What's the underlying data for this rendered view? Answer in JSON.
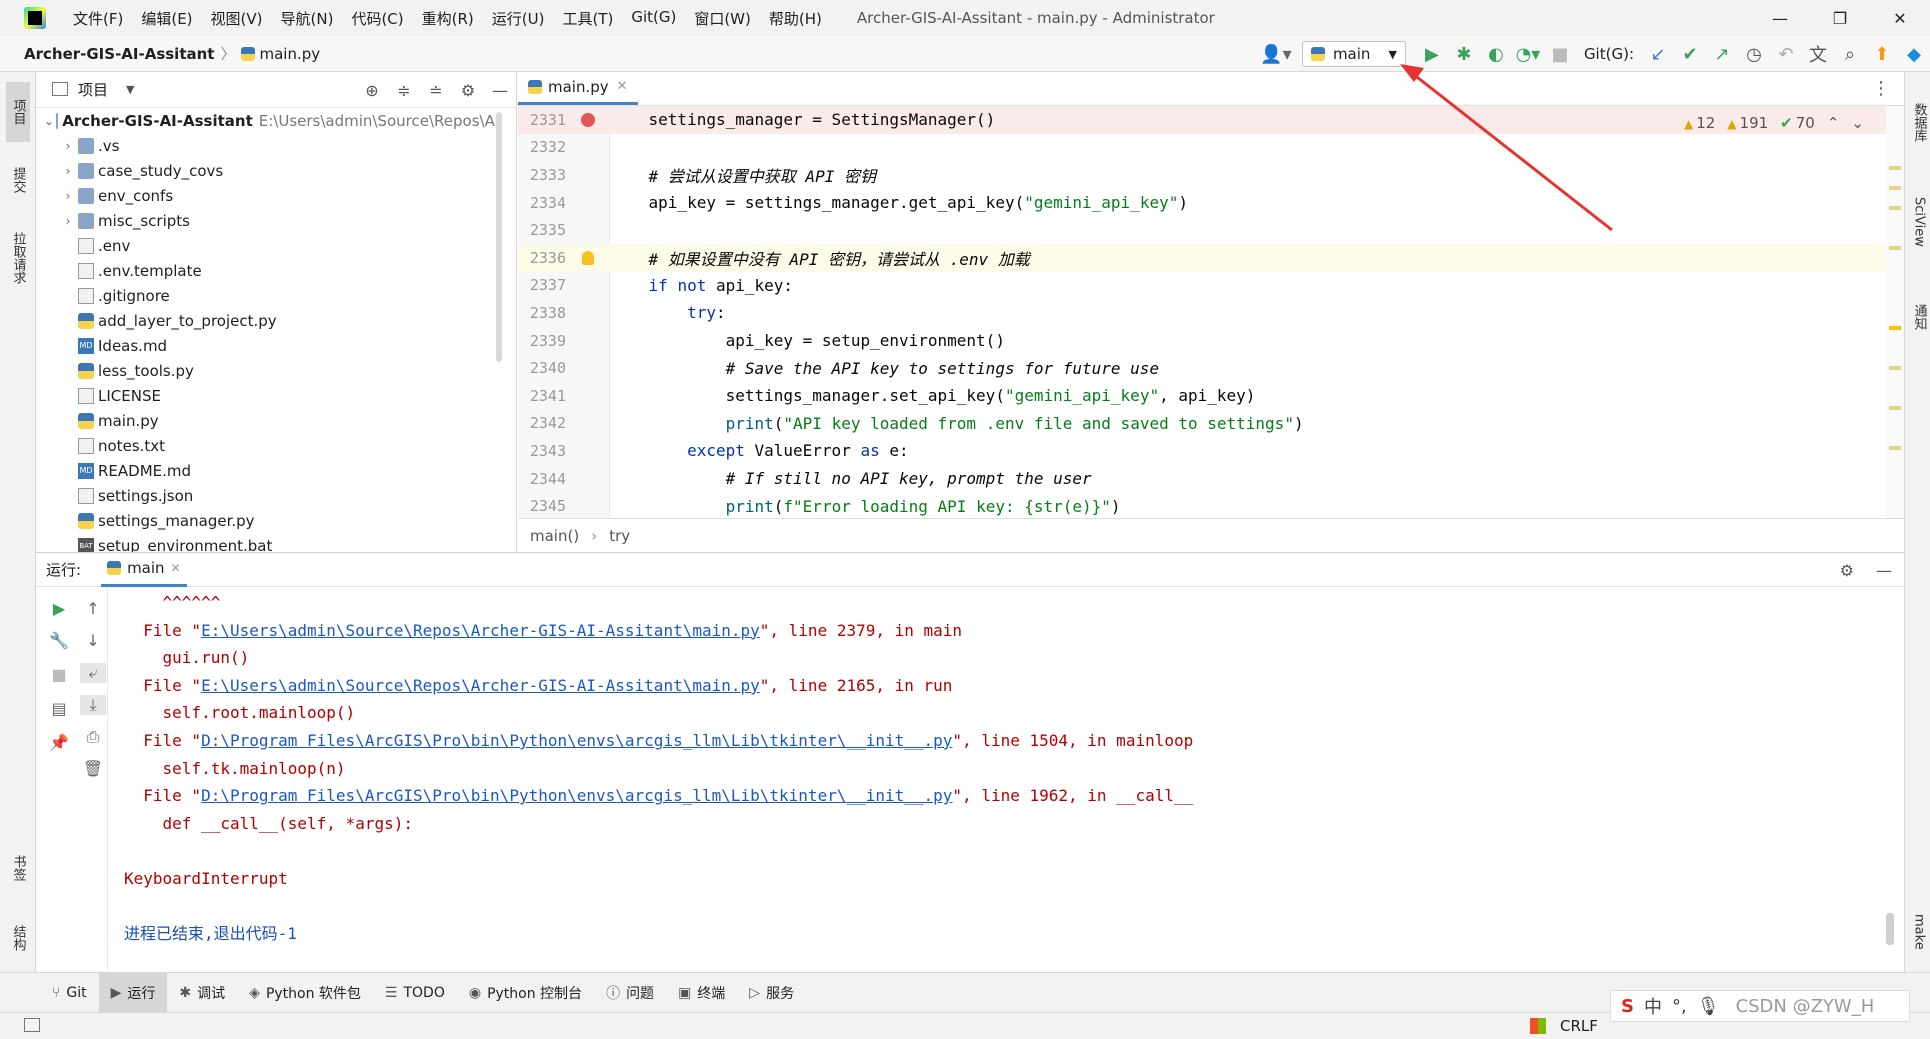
{
  "window": {
    "title": "Archer-GIS-AI-Assitant - main.py - Administrator",
    "menu": [
      "文件(F)",
      "编辑(E)",
      "视图(V)",
      "导航(N)",
      "代码(C)",
      "重构(R)",
      "运行(U)",
      "工具(T)",
      "Git(G)",
      "窗口(W)",
      "帮助(H)"
    ]
  },
  "navbar": {
    "project": "Archer-GIS-AI-Assitant",
    "file": "main.py",
    "run_config": "main",
    "git_label": "Git(G):"
  },
  "left_strip": {
    "project": "项目",
    "commit": "提交",
    "pull": "拉取请求",
    "bookmarks": "书签",
    "structure": "结构"
  },
  "right_strip": {
    "database": "数据库",
    "sciview": "SciView",
    "notifications": "通知",
    "make": "make"
  },
  "project_panel": {
    "title": "项目",
    "root": "Archer-GIS-AI-Assitant",
    "root_path": "E:\\Users\\admin\\Source\\Repos\\Ar",
    "items": [
      {
        "name": ".vs",
        "type": "folder"
      },
      {
        "name": "case_study_covs",
        "type": "folder"
      },
      {
        "name": "env_confs",
        "type": "folder"
      },
      {
        "name": "misc_scripts",
        "type": "folder"
      },
      {
        "name": ".env",
        "type": "file"
      },
      {
        "name": ".env.template",
        "type": "file"
      },
      {
        "name": ".gitignore",
        "type": "file"
      },
      {
        "name": "add_layer_to_project.py",
        "type": "py"
      },
      {
        "name": "Ideas.md",
        "type": "md"
      },
      {
        "name": "less_tools.py",
        "type": "py"
      },
      {
        "name": "LICENSE",
        "type": "file"
      },
      {
        "name": "main.py",
        "type": "py"
      },
      {
        "name": "notes.txt",
        "type": "file"
      },
      {
        "name": "README.md",
        "type": "md"
      },
      {
        "name": "settings.json",
        "type": "file"
      },
      {
        "name": "settings_manager.py",
        "type": "py"
      },
      {
        "name": "setup_environment.bat",
        "type": "bat"
      }
    ]
  },
  "editor": {
    "tab": "main.py",
    "inspections": {
      "warnings": "12",
      "weak_warnings": "191",
      "ok": "70"
    },
    "lines": [
      {
        "n": "2331",
        "code": "    settings_manager = SettingsManager()",
        "hl": "red",
        "marker": "bp"
      },
      {
        "n": "2332",
        "code": ""
      },
      {
        "n": "2333",
        "code": "    # 尝试从设置中获取 API 密钥",
        "cls": "cm"
      },
      {
        "n": "2334",
        "code": "    api_key = settings_manager.get_api_key(\"gemini_api_key\")"
      },
      {
        "n": "2335",
        "code": ""
      },
      {
        "n": "2336",
        "code": "    # 如果设置中没有 API 密钥，请尝试从 .env 加载",
        "cls": "cm",
        "hl": "yel",
        "marker": "bulb"
      },
      {
        "n": "2337",
        "code": "    if not api_key:"
      },
      {
        "n": "2338",
        "code": "        try:"
      },
      {
        "n": "2339",
        "code": "            api_key = setup_environment()"
      },
      {
        "n": "2340",
        "code": "            # Save the API key to settings for future use",
        "cls": "cm"
      },
      {
        "n": "2341",
        "code": "            settings_manager.set_api_key(\"gemini_api_key\", api_key)"
      },
      {
        "n": "2342",
        "code": "            print(\"API key loaded from .env file and saved to settings\")"
      },
      {
        "n": "2343",
        "code": "        except ValueError as e:"
      },
      {
        "n": "2344",
        "code": "            # If still no API key, prompt the user",
        "cls": "cm"
      },
      {
        "n": "2345",
        "code": "            print(f\"Error loading API key: {str(e)}\")"
      }
    ],
    "breadcrumb": [
      "main()",
      "try"
    ]
  },
  "run_panel": {
    "label": "运行:",
    "tab": "main",
    "console": [
      {
        "text": "    ^^^^^^"
      },
      {
        "pre": "  File \"",
        "link": "E:\\Users\\admin\\Source\\Repos\\Archer-GIS-AI-Assitant\\main.py",
        "post": "\", line 2379, in main"
      },
      {
        "text": "    gui.run()"
      },
      {
        "pre": "  File \"",
        "link": "E:\\Users\\admin\\Source\\Repos\\Archer-GIS-AI-Assitant\\main.py",
        "post": "\", line 2165, in run"
      },
      {
        "text": "    self.root.mainloop()"
      },
      {
        "pre": "  File \"",
        "link": "D:\\Program Files\\ArcGIS\\Pro\\bin\\Python\\envs\\arcgis_llm\\Lib\\tkinter\\__init__.py",
        "post": "\", line 1504, in mainloop"
      },
      {
        "text": "    self.tk.mainloop(n)"
      },
      {
        "pre": "  File \"",
        "link": "D:\\Program Files\\ArcGIS\\Pro\\bin\\Python\\envs\\arcgis_llm\\Lib\\tkinter\\__init__.py",
        "post": "\", line 1962, in __call__"
      },
      {
        "text": "    def __call__(self, *args):"
      },
      {
        "text": ""
      },
      {
        "text": "KeyboardInterrupt"
      },
      {
        "text": ""
      },
      {
        "text": "进程已结束,退出代码-1",
        "cls": "blue"
      }
    ]
  },
  "bottom_tabs": [
    "Git",
    "运行",
    "调试",
    "Python 软件包",
    "TODO",
    "Python 控制台",
    "问题",
    "终端",
    "服务"
  ],
  "status": {
    "line_sep": "CRLF"
  },
  "ime": {
    "lang": "中",
    "watermark": "CSDN @ZYW_H"
  },
  "colors": {
    "accent": "#4083c9",
    "error": "#b30000",
    "link": "#1a58c4",
    "run_green": "#3aa357",
    "annotation_arrow": "#e8322f"
  }
}
